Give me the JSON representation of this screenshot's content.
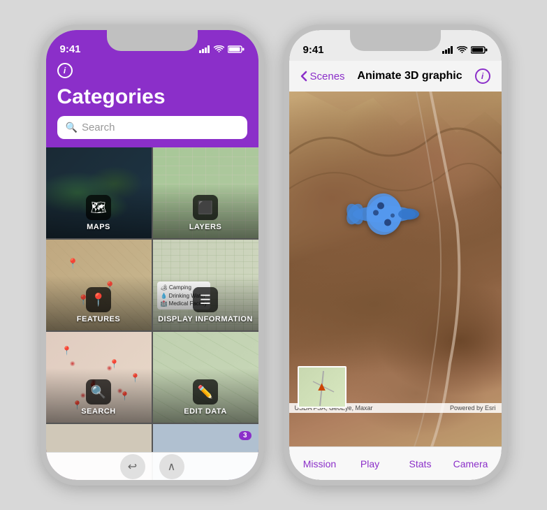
{
  "left_phone": {
    "status": {
      "time": "9:41",
      "signal": "signal",
      "wifi": "wifi",
      "battery": "battery"
    },
    "header": {
      "info_icon": "ⓘ",
      "title": "Categories",
      "search_placeholder": "Search"
    },
    "grid": [
      {
        "id": "maps",
        "label": "MAPS",
        "icon": "🗺",
        "bg": "world"
      },
      {
        "id": "layers",
        "label": "LAYERS",
        "icon": "⬛",
        "bg": "street"
      },
      {
        "id": "features",
        "label": "FEATURES",
        "icon": "📍",
        "bg": "features"
      },
      {
        "id": "display-information",
        "label": "DISPLAY INFORMATION",
        "icon": "☰",
        "bg": "display"
      },
      {
        "id": "search",
        "label": "SEARCH",
        "icon": "🔍",
        "bg": "search"
      },
      {
        "id": "edit-data",
        "label": "EDIT DATA",
        "icon": "✏",
        "bg": "edit"
      }
    ],
    "bottom_nav": {
      "back": "↩",
      "chevron": "∧"
    }
  },
  "right_phone": {
    "status": {
      "time": "9:41"
    },
    "nav": {
      "back_label": "Scenes",
      "title": "Animate 3D graphic",
      "info_icon": "ⓘ"
    },
    "attribution": {
      "left": "USDA FSA, GeoEye, Maxar",
      "right": "Powered by Esri"
    },
    "tabs": [
      {
        "id": "mission",
        "label": "Mission"
      },
      {
        "id": "play",
        "label": "Play"
      },
      {
        "id": "stats",
        "label": "Stats"
      },
      {
        "id": "camera",
        "label": "Camera"
      }
    ]
  }
}
